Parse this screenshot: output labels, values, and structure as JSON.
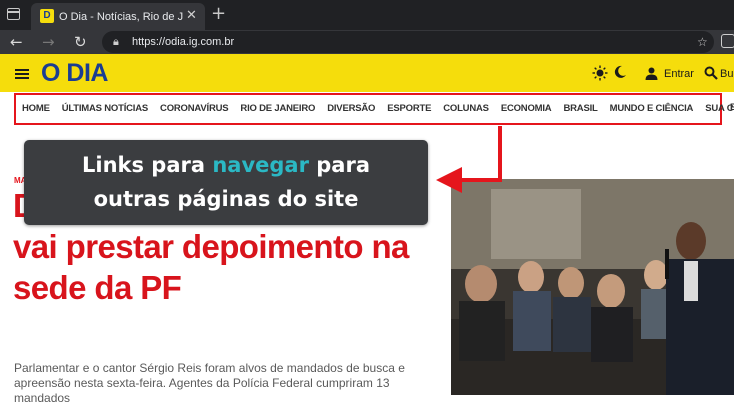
{
  "browser": {
    "tab_title": "O Dia - Notícias, Rio de Janeiro, ...",
    "tab_favicon": "D",
    "tab_close": "✕",
    "new_tab": "+",
    "url": "https://odia.ig.com.br",
    "icons": [
      "window-icon",
      "back-icon",
      "forward-icon",
      "reload-icon",
      "lock-icon",
      "star-icon",
      "extensions-icon"
    ]
  },
  "site": {
    "logo": "O DIA",
    "login_label": "Entrar",
    "search_label": "Bu",
    "brand_yellow": "#f5dd0c",
    "brand_blue": "#1a3d92",
    "accent_red": "#e5151c",
    "nav_items": [
      "HOME",
      "ÚLTIMAS NOTÍCIAS",
      "CORONAVÍRUS",
      "RIO DE JANEIRO",
      "DIVERSÃO",
      "ESPORTE",
      "COLUNAS",
      "ECONOMIA",
      "BRASIL",
      "MUNDO E CIÊNCIA",
      "SUA CIDADE"
    ],
    "nav_overflow": "E"
  },
  "article": {
    "kicker": "MA",
    "headline": "D... de Paula é intimado e vai prestar depoimento na sede da PF",
    "summary": "Parlamentar e o cantor Sérgio Reis foram alvos de mandados de busca e apreensão nesta sexta-feira. Agentes da Polícia Federal cumpriram 13 mandados"
  },
  "annotation": {
    "line1_before": "Links para ",
    "line1_highlight": "navegar",
    "line1_after": " para",
    "line2": "outras páginas do site",
    "highlight_color": "#2bb8c4"
  }
}
